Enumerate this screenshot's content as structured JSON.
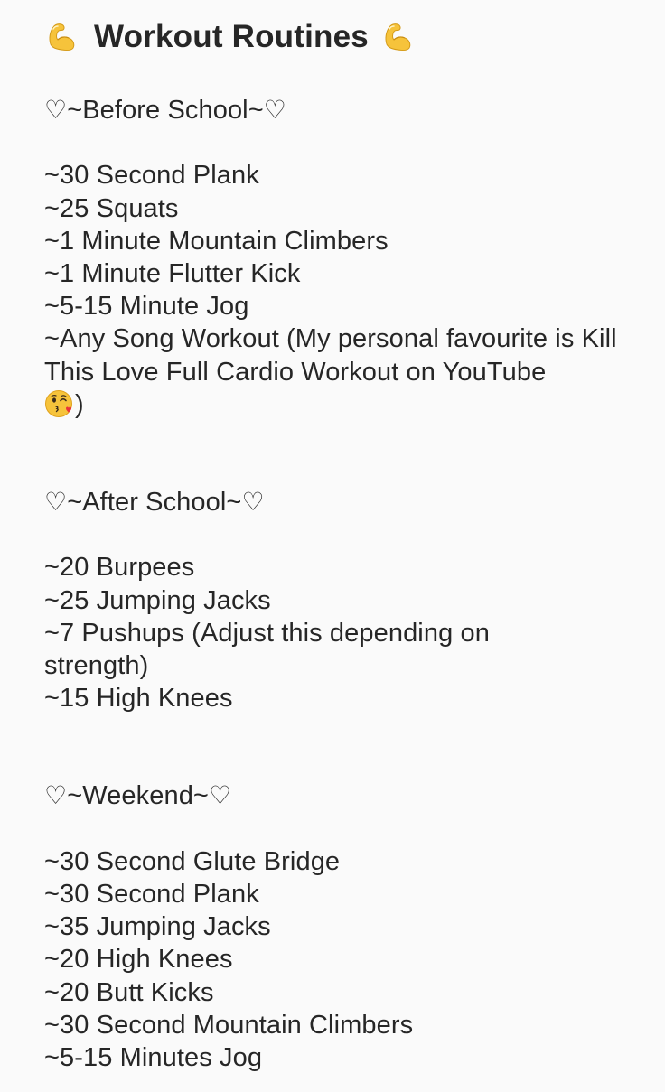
{
  "title": {
    "text": "Workout Routines",
    "left_icon": "flexed-biceps-icon",
    "right_icon": "flexed-biceps-icon"
  },
  "sections": [
    {
      "header": {
        "prefix_icon": "white-heart-icon",
        "text": "~Before School~",
        "suffix_icon": "white-heart-icon"
      },
      "items": [
        "~30 Second Plank",
        "~25 Squats",
        "~1 Minute Mountain Climbers",
        "~1 Minute Flutter Kick",
        "~5-15 Minute Jog",
        "~Any Song Workout (My personal favourite is Kill This Love Full Cardio Workout on YouTube"
      ],
      "last_item_suffix": ")",
      "last_item_emoji": "face-blowing-kiss-icon"
    },
    {
      "header": {
        "prefix_icon": "white-heart-icon",
        "text": "~After School~",
        "suffix_icon": "white-heart-icon"
      },
      "items": [
        "~20 Burpees",
        "~25 Jumping Jacks",
        "~7 Pushups (Adjust this depending on strength)",
        "~15 High Knees"
      ]
    },
    {
      "header": {
        "prefix_icon": "white-heart-icon",
        "text": "~Weekend~",
        "suffix_icon": "white-heart-icon"
      },
      "items": [
        "~30 Second Glute Bridge",
        "~30 Second Plank",
        "~35 Jumping Jacks",
        "~20 High Knees",
        "~20 Butt Kicks",
        "~30 Second Mountain Climbers",
        "~5-15 Minutes Jog"
      ]
    }
  ],
  "glyphs": {
    "heart": "♡"
  },
  "colors": {
    "background": "#fafafa",
    "text": "#262626",
    "emoji_yellow": "#f6c33b",
    "emoji_shade": "#e0a21c",
    "kiss_heart": "#e8333a"
  }
}
